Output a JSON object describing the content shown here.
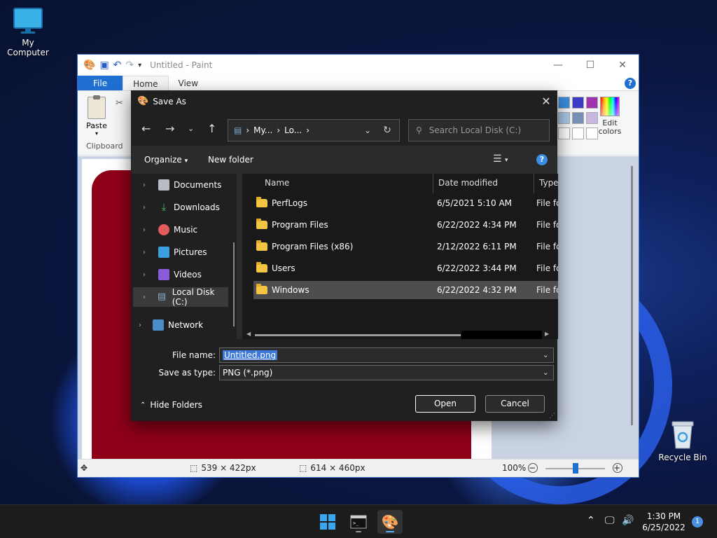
{
  "desktop": {
    "icons": [
      {
        "label": "My Computer",
        "icon": "monitor-icon"
      },
      {
        "label": "Recycle Bin",
        "icon": "recycle-bin-icon"
      }
    ]
  },
  "paint": {
    "title": "Untitled - Paint",
    "tabs": [
      "File",
      "Home",
      "View"
    ],
    "paste_label": "Paste",
    "clipboard_label": "Clipboard",
    "edit_colors_label": "Edit colors",
    "status": {
      "selection_size": "539 × 422px",
      "canvas_size": "614 × 460px",
      "zoom": "100%",
      "zoom_out": "−",
      "zoom_in": "+"
    },
    "colors": {
      "canvas_fill": "#8f0018",
      "accent": "#1e6fd0"
    }
  },
  "save_as": {
    "title": "Save As",
    "address": {
      "parts": [
        "My...",
        "Lo..."
      ]
    },
    "search_placeholder": "Search Local Disk (C:)",
    "organize_label": "Organize",
    "new_folder_label": "New folder",
    "nav_items": [
      {
        "label": "Documents",
        "icon": "documents-icon"
      },
      {
        "label": "Downloads",
        "icon": "downloads-icon"
      },
      {
        "label": "Music",
        "icon": "music-icon"
      },
      {
        "label": "Pictures",
        "icon": "pictures-icon"
      },
      {
        "label": "Videos",
        "icon": "videos-icon"
      },
      {
        "label": "Local Disk (C:)",
        "icon": "drive-icon",
        "selected": true
      },
      {
        "label": "Network",
        "icon": "network-icon"
      }
    ],
    "columns": [
      "Name",
      "Date modified",
      "Type"
    ],
    "files": [
      {
        "name": "PerfLogs",
        "date": "6/5/2021 5:10 AM",
        "type": "File fo"
      },
      {
        "name": "Program Files",
        "date": "6/22/2022 4:34 PM",
        "type": "File fo"
      },
      {
        "name": "Program Files (x86)",
        "date": "2/12/2022 6:11 PM",
        "type": "File fo"
      },
      {
        "name": "Users",
        "date": "6/22/2022 3:44 PM",
        "type": "File fo"
      },
      {
        "name": "Windows",
        "date": "6/22/2022 4:32 PM",
        "type": "File fo",
        "selected": true
      }
    ],
    "file_name_label": "File name:",
    "file_name_value": "Untitled.png",
    "save_type_label": "Save as type:",
    "save_type_value": "PNG (*.png)",
    "hide_folders_label": "Hide Folders",
    "open_label": "Open",
    "cancel_label": "Cancel"
  },
  "taskbar": {
    "apps": [
      {
        "icon": "start-icon"
      },
      {
        "icon": "terminal-icon"
      },
      {
        "icon": "paint-icon",
        "active": true
      }
    ],
    "time": "1:30 PM",
    "date": "6/25/2022",
    "notifications": "1"
  }
}
